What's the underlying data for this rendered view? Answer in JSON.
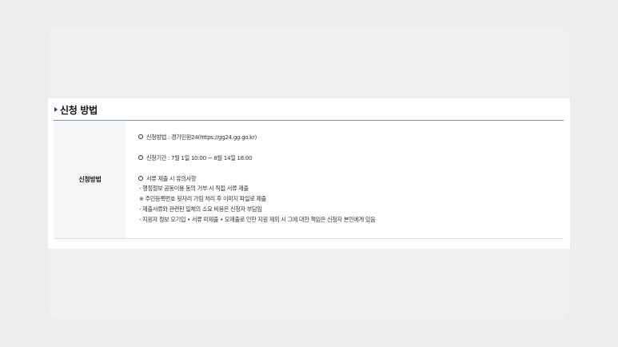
{
  "section": {
    "title": "신청 방법"
  },
  "table": {
    "header_label": "신청방법",
    "items": [
      {
        "text": "신청방법 : 경기민원24(https://gg24.gg.go.kr)"
      },
      {
        "text": "신청기간 : 7월 1일 10:00 ~ 8월 14일 18:00"
      },
      {
        "text": "서류 제출 시 유의사항"
      }
    ],
    "notes": [
      "- 행정정보 공동이용 동의 거부 시 직접 서류 제출",
      "※ 주민등록번호 뒷자리 가림 처리 후 이미지 파일로 제출",
      "- 제출서류와 관련된 일체의 소요 비용은 신청자 부담임",
      "- 지원자 정보 오기입 • 서류 미제출 • 오제출로 인한 지원 제외 시 그에 대한 책임은 신청자 본인에게 있음"
    ]
  },
  "colors": {
    "marker": "#1f3f8a",
    "table_border_top": "#7d93b0",
    "header_cell_bg": "#f5f6f8"
  }
}
